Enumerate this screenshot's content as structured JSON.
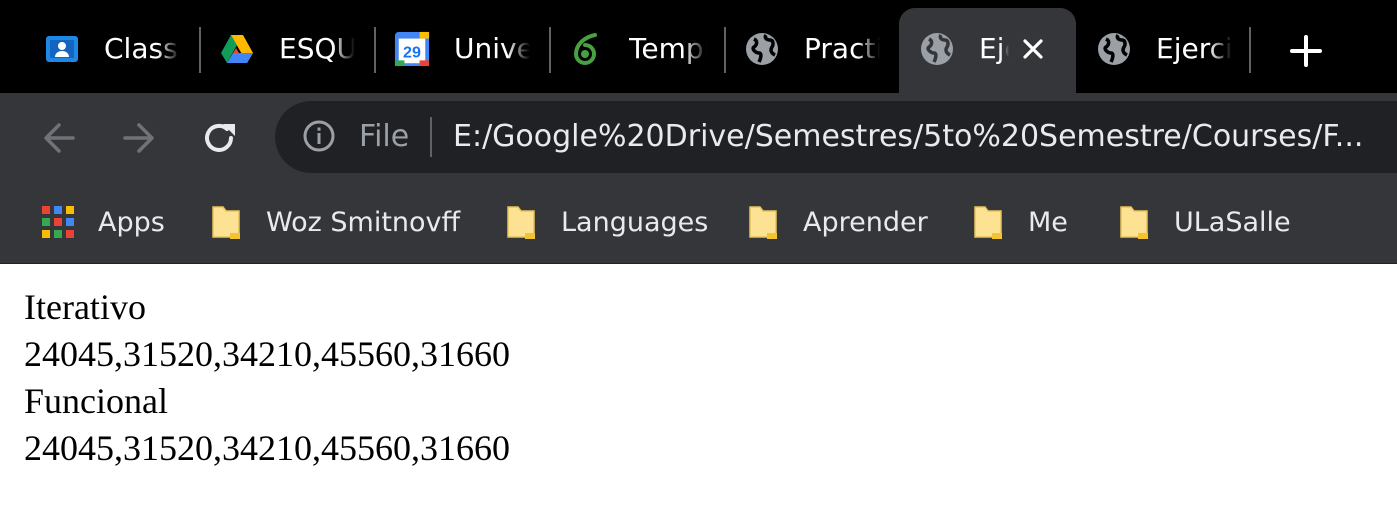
{
  "tabs": [
    {
      "title": "Classwork",
      "icon": "google-classroom-icon",
      "active": false
    },
    {
      "title": "ESQUEMA",
      "icon": "google-drive-icon",
      "active": false
    },
    {
      "title": "Universidad",
      "icon": "google-calendar-icon",
      "calendar_day": "29",
      "active": false
    },
    {
      "title": "Template",
      "icon": "overleaf-icon",
      "active": false
    },
    {
      "title": "Practica",
      "icon": "globe-icon",
      "active": false
    },
    {
      "title": "Ejercicio",
      "icon": "globe-icon",
      "active": true
    },
    {
      "title": "Ejercicio",
      "icon": "globe-icon",
      "active": false
    }
  ],
  "toolbar": {
    "scheme_label": "File",
    "url": "E:/Google%20Drive/Semestres/5to%20Semestre/Courses/F..."
  },
  "bookmarks": [
    {
      "label": "Apps",
      "icon": "apps-grid-icon"
    },
    {
      "label": "Woz Smitnovff",
      "icon": "folder-icon"
    },
    {
      "label": "Languages",
      "icon": "folder-icon"
    },
    {
      "label": "Aprender",
      "icon": "folder-icon"
    },
    {
      "label": "Me",
      "icon": "folder-icon"
    },
    {
      "label": "ULaSalle",
      "icon": "folder-icon"
    }
  ],
  "content": {
    "lines": [
      "Iterativo",
      "24045,31520,34210,45560,31660",
      "Funcional",
      "24045,31520,34210,45560,31660"
    ]
  },
  "colors": {
    "tabstrip": "#000000",
    "toolbar": "#35363a",
    "omnibox": "#202124",
    "folder": "#fde293",
    "text_light": "#e8eaed"
  }
}
